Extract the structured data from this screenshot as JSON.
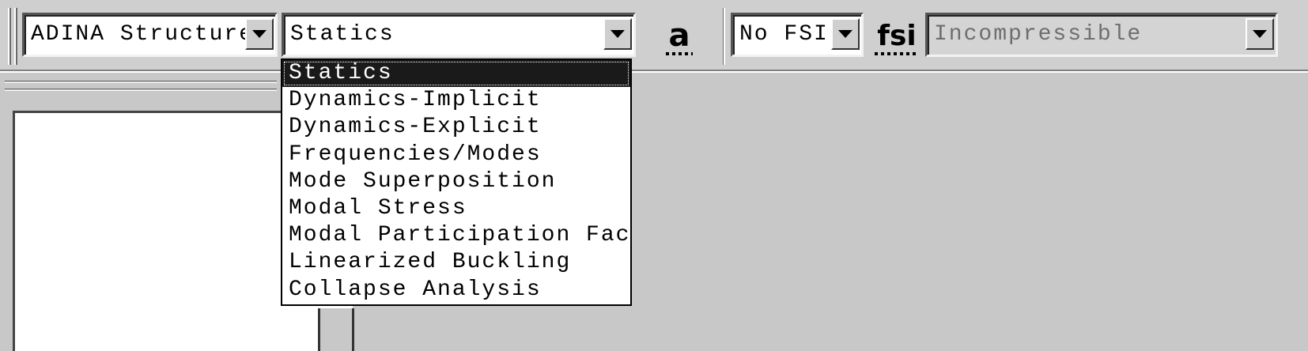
{
  "toolbar": {
    "program_select": {
      "value": "ADINA Structure",
      "icon": "chevron-down-icon"
    },
    "analysis_select": {
      "value": "Statics",
      "icon": "chevron-down-icon"
    },
    "analysis_options_icon": {
      "label": "a",
      "icon": "analysis-options-icon"
    },
    "fsi_select": {
      "value": "No FSI",
      "icon": "chevron-down-icon"
    },
    "fsi_icon": {
      "label": "fsi",
      "icon": "fsi-icon"
    },
    "fluid_model_select": {
      "value": "Incompressible",
      "disabled": true,
      "icon": "chevron-down-icon"
    }
  },
  "analysis_dropdown": {
    "options": [
      "Statics",
      "Dynamics-Implicit",
      "Dynamics-Explicit",
      "Frequencies/Modes",
      "Mode Superposition",
      "Modal Stress",
      "Modal Participation Factor",
      "Linearized Buckling",
      "Collapse Analysis"
    ],
    "selected_index": 0
  },
  "colors": {
    "toolbar_bg": "#cfcfcf",
    "highlight_bg": "#1a1a1a",
    "highlight_text": "#ffffff"
  }
}
